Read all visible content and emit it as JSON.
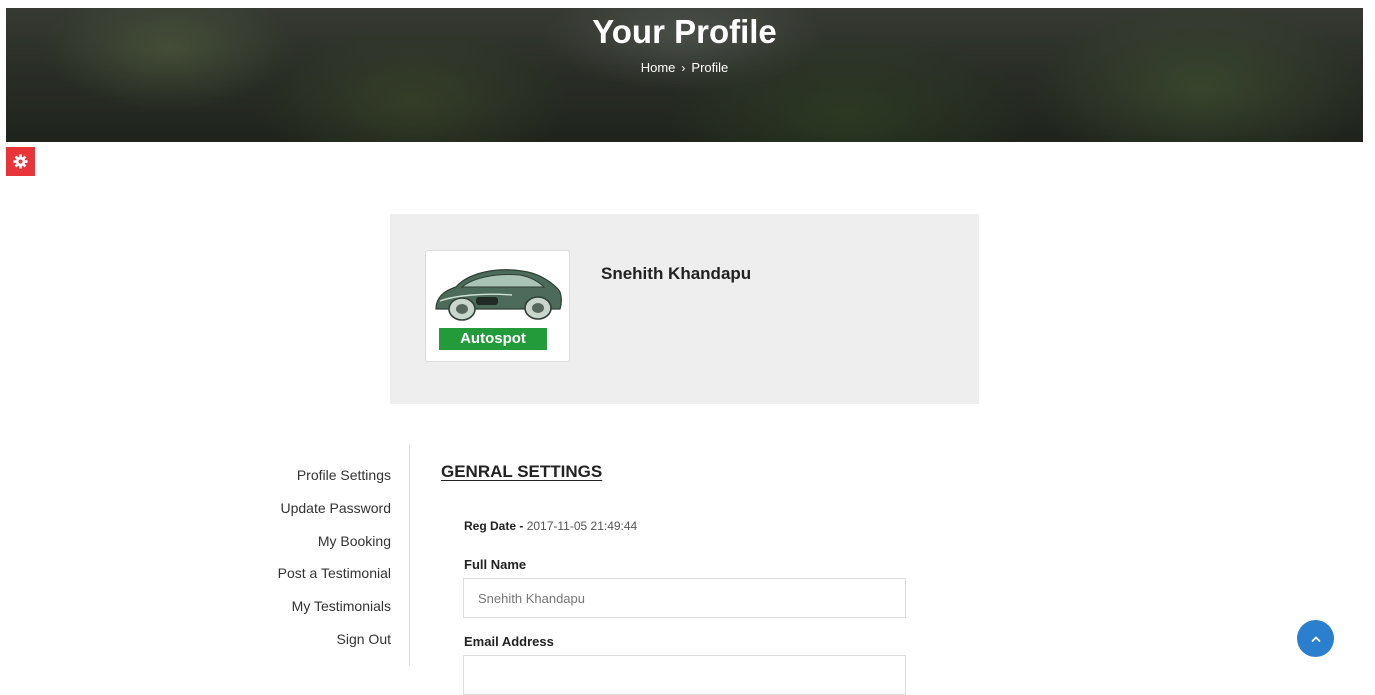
{
  "header": {
    "title": "Your Profile",
    "breadcrumb": {
      "home": "Home",
      "separator": "›",
      "current": "Profile"
    }
  },
  "settings_button": {
    "icon": "gear-icon",
    "color": "#e8353a"
  },
  "profile": {
    "name": "Snehith Khandapu",
    "logo_text": "Autospot",
    "logo_color": "#239b3b"
  },
  "sidebar": {
    "items": [
      {
        "label": "Profile Settings"
      },
      {
        "label": "Update Password"
      },
      {
        "label": "My Booking"
      },
      {
        "label": "Post a Testimonial"
      },
      {
        "label": "My Testimonials"
      },
      {
        "label": "Sign Out"
      }
    ]
  },
  "settings": {
    "title": "GENRAL SETTINGS",
    "reg_date_label": "Reg Date -",
    "reg_date_value": "2017-11-05 21:49:44",
    "full_name_label": "Full Name",
    "full_name_value": "Snehith Khandapu",
    "email_label": "Email Address",
    "email_value": ""
  },
  "back_to_top": {
    "icon": "chevron-up-icon",
    "color": "#2a7fcf"
  }
}
